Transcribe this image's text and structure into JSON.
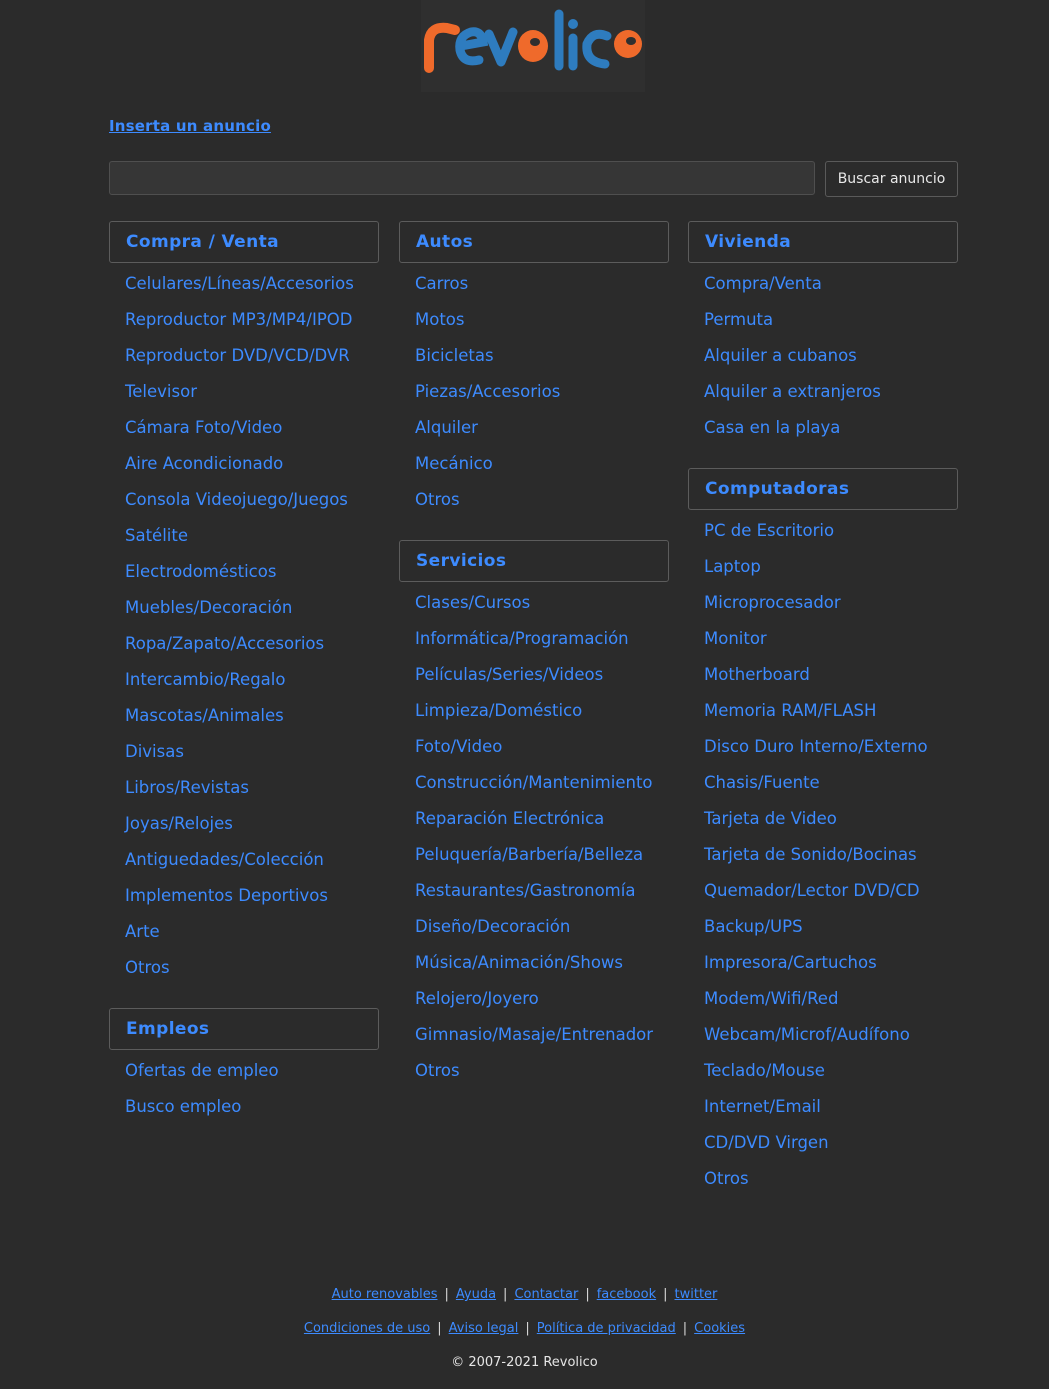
{
  "brand": {
    "logo_text": "revolico",
    "colors": {
      "orange": "#ef6a2b",
      "blue": "#2e7cbf"
    }
  },
  "header": {
    "insert_label": "Inserta un anuncio",
    "search_placeholder": "",
    "search_button_label": "Buscar anuncio"
  },
  "columns": {
    "col1": {
      "compra": {
        "title": "Compra / Venta",
        "items": [
          "Celulares/Líneas/Accesorios",
          "Reproductor MP3/MP4/IPOD",
          "Reproductor DVD/VCD/DVR",
          "Televisor",
          "Cámara Foto/Video",
          "Aire Acondicionado",
          "Consola Videojuego/Juegos",
          "Satélite",
          "Electrodomésticos",
          "Muebles/Decoración",
          "Ropa/Zapato/Accesorios",
          "Intercambio/Regalo",
          "Mascotas/Animales",
          "Divisas",
          "Libros/Revistas",
          "Joyas/Relojes",
          "Antiguedades/Colección",
          "Implementos Deportivos",
          "Arte",
          "Otros"
        ]
      },
      "empleos": {
        "title": "Empleos",
        "items": [
          "Ofertas de empleo",
          "Busco empleo"
        ]
      }
    },
    "col2": {
      "autos": {
        "title": "Autos",
        "items": [
          "Carros",
          "Motos",
          "Bicicletas",
          "Piezas/Accesorios",
          "Alquiler",
          "Mecánico",
          "Otros"
        ]
      },
      "servicios": {
        "title": "Servicios",
        "items": [
          "Clases/Cursos",
          "Informática/Programación",
          "Películas/Series/Videos",
          "Limpieza/Doméstico",
          "Foto/Video",
          "Construcción/Mantenimiento",
          "Reparación Electrónica",
          "Peluquería/Barbería/Belleza",
          "Restaurantes/Gastronomía",
          "Diseño/Decoración",
          "Música/Animación/Shows",
          "Relojero/Joyero",
          "Gimnasio/Masaje/Entrenador",
          "Otros"
        ]
      }
    },
    "col3": {
      "vivienda": {
        "title": "Vivienda",
        "items": [
          "Compra/Venta",
          "Permuta",
          "Alquiler a cubanos",
          "Alquiler a extranjeros",
          "Casa en la playa"
        ]
      },
      "computadoras": {
        "title": "Computadoras",
        "items": [
          "PC de Escritorio",
          "Laptop",
          "Microprocesador",
          "Monitor",
          "Motherboard",
          "Memoria RAM/FLASH",
          "Disco Duro Interno/Externo",
          "Chasis/Fuente",
          "Tarjeta de Video",
          "Tarjeta de Sonido/Bocinas",
          "Quemador/Lector DVD/CD",
          "Backup/UPS",
          "Impresora/Cartuchos",
          "Modem/Wifi/Red",
          "Webcam/Microf/Audífono",
          "Teclado/Mouse",
          "Internet/Email",
          "CD/DVD Virgen",
          "Otros"
        ]
      }
    }
  },
  "footer": {
    "row1": [
      "Auto renovables",
      "Ayuda",
      "Contactar",
      "facebook",
      "twitter"
    ],
    "row2": [
      "Condiciones de uso",
      "Aviso legal",
      "Política de privacidad",
      "Cookies"
    ],
    "separator": "|",
    "copyright": "© 2007-2021 Revolico"
  }
}
